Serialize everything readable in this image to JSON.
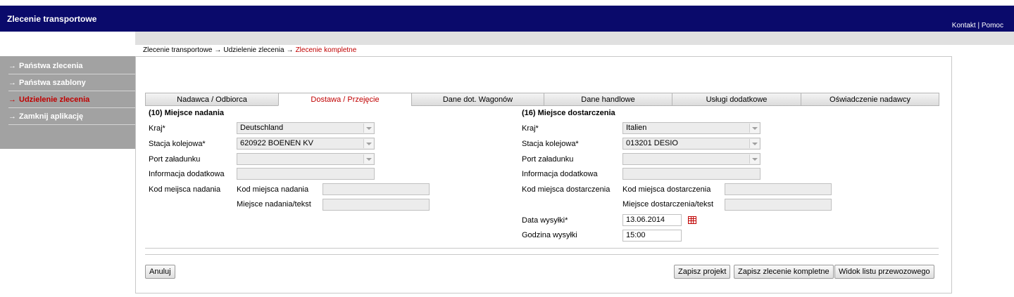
{
  "app": {
    "title": "Zlecenie transportowe"
  },
  "top_links": {
    "contact": "Kontakt",
    "separator": "|",
    "help": "Pomoc"
  },
  "breadcrumb": {
    "items": [
      "Zlecenie transportowe",
      "Udzielenie zlecenia",
      "Zlecenie kompletne"
    ],
    "separator": "→"
  },
  "sidebar": {
    "arrow": "→",
    "items": [
      {
        "label": "Państwa zlecenia"
      },
      {
        "label": "Państwa szablony"
      },
      {
        "label": "Udzielenie zlecenia",
        "active": true
      },
      {
        "label": "Zamknij aplikację"
      }
    ]
  },
  "tabs": [
    {
      "label": "Nadawca / Odbiorca"
    },
    {
      "label": "Dostawa / Przejęcie",
      "active": true
    },
    {
      "label": "Dane dot. Wagonów"
    },
    {
      "label": "Dane handlowe"
    },
    {
      "label": "Usługi dodatkowe"
    },
    {
      "label": "Oświadczenie nadawcy"
    }
  ],
  "origin": {
    "title": "(10) Miejsce nadania",
    "country_label": "Kraj*",
    "country_value": "Deutschland",
    "station_label": "Stacja kolejowa*",
    "station_value": "620922 BOENEN KV",
    "port_label": "Port załadunku",
    "port_value": "",
    "info_label": "Informacja dodatkowa",
    "info_value": "",
    "code_group_label": "Kod meijsca nadania",
    "code_label": "Kod miejsca nadania",
    "code_value": "",
    "text_label": "Miejsce nadania/tekst",
    "text_value": ""
  },
  "destination": {
    "title": "(16) Miejsce dostarczenia",
    "country_label": "Kraj*",
    "country_value": "Italien",
    "station_label": "Stacja kolejowa*",
    "station_value": "013201 DESIO",
    "port_label": "Port załadunku",
    "port_value": "",
    "info_label": "Informacja dodatkowa",
    "info_value": "",
    "code_group_label": "Kod miejsca dostarczenia",
    "code_label": "Kod miejsca dostarczenia",
    "code_value": "",
    "text_label": "Miejsce dostarczenia/tekst",
    "text_value": "",
    "date_label": "Data wysyłki*",
    "date_value": "13.06.2014",
    "time_label": "Godzina wysyłki",
    "time_value": "15:00"
  },
  "buttons": {
    "cancel": "Anuluj",
    "save_draft": "Zapisz projekt",
    "save_complete": "Zapisz zlecenie kompletne",
    "waybill_view": "Widok listu przewozowego"
  },
  "colors": {
    "header_bg": "#0a0a6b",
    "accent_red": "#c00000",
    "sidebar_bg": "#a2a2a2"
  }
}
